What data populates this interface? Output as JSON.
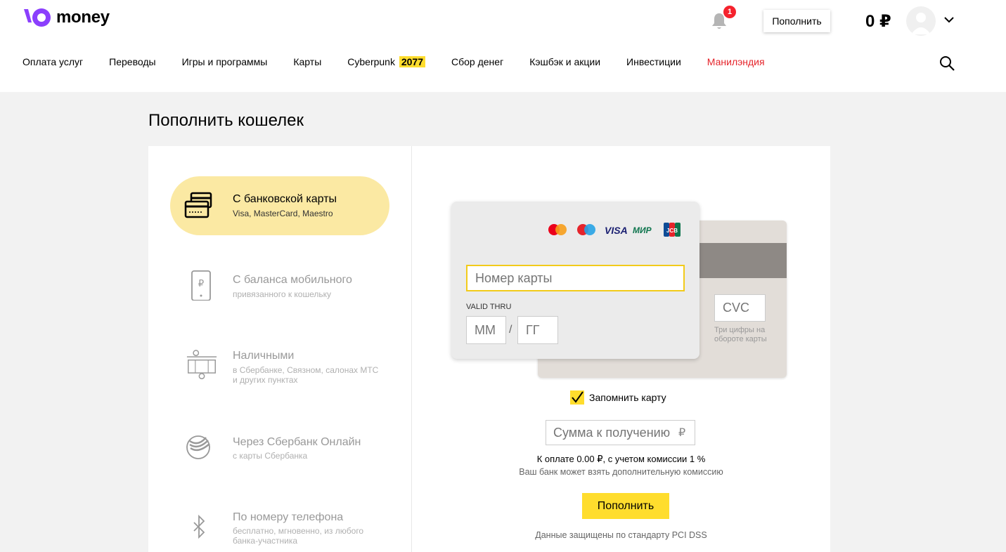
{
  "header": {
    "logo_text": "money",
    "notifications_count": "1",
    "topup_label": "Пополнить",
    "balance": "0 ₽"
  },
  "nav": {
    "items": [
      {
        "label": "Оплата услуг"
      },
      {
        "label": "Переводы"
      },
      {
        "label": "Игры и программы"
      },
      {
        "label": "Карты"
      },
      {
        "label": "Cyberpunk",
        "badge": "2077"
      },
      {
        "label": "Сбор денег"
      },
      {
        "label": "Кэшбэк и акции"
      },
      {
        "label": "Инвестиции"
      },
      {
        "label": "Манилэндия",
        "color": "#e5242b"
      }
    ]
  },
  "page": {
    "title": "Пополнить кошелек"
  },
  "methods": [
    {
      "title": "С банковской карты",
      "subtitle": "Visa, MasterCard, Maestro",
      "icon": "bank-card-icon",
      "active": true
    },
    {
      "title": "С баланса мобильного",
      "subtitle": "привязанного к кошельку",
      "icon": "mobile-phone-icon",
      "active": false
    },
    {
      "title": "Наличными",
      "subtitle": "в Сбербанке, Связном, салонах МТС и других пунктах",
      "icon": "cash-terminal-icon",
      "active": false
    },
    {
      "title": "Через Сбербанк Онлайн",
      "subtitle": "с карты Сбербанка",
      "icon": "sberbank-icon",
      "active": false
    },
    {
      "title": "По номеру телефона",
      "subtitle": "бесплатно, мгновенно, из любого банка-участника",
      "icon": "bluetooth-icon",
      "active": false
    }
  ],
  "card_form": {
    "card_brands": [
      "mastercard",
      "maestro",
      "VISA",
      "МИР",
      "JCB"
    ],
    "card_number_placeholder": "Номер карты",
    "valid_thru_label": "VALID THRU",
    "month_placeholder": "ММ",
    "date_separator": "/",
    "year_placeholder": "ГГ",
    "cvc_placeholder": "CVC",
    "cvc_hint": "Три цифры на обороте карты",
    "remember_label": "Запомнить карту",
    "remember_checked": true,
    "amount_placeholder": "Сумма к получению",
    "currency_sign": "₽",
    "pay_info": "К оплате 0.00 ₽, с учетом комиссии 1 %",
    "bank_note": "Ваш банк может взять дополнительную комиссию",
    "submit_label": "Пополнить",
    "security_note": "Данные защищены по стандарту PCI DSS"
  },
  "colors": {
    "accent_yellow": "#ffdd2d",
    "active_method_bg": "#fbe9a3",
    "brand_purple": "#8b3ffd",
    "nav_highlight": "#e5242b"
  }
}
